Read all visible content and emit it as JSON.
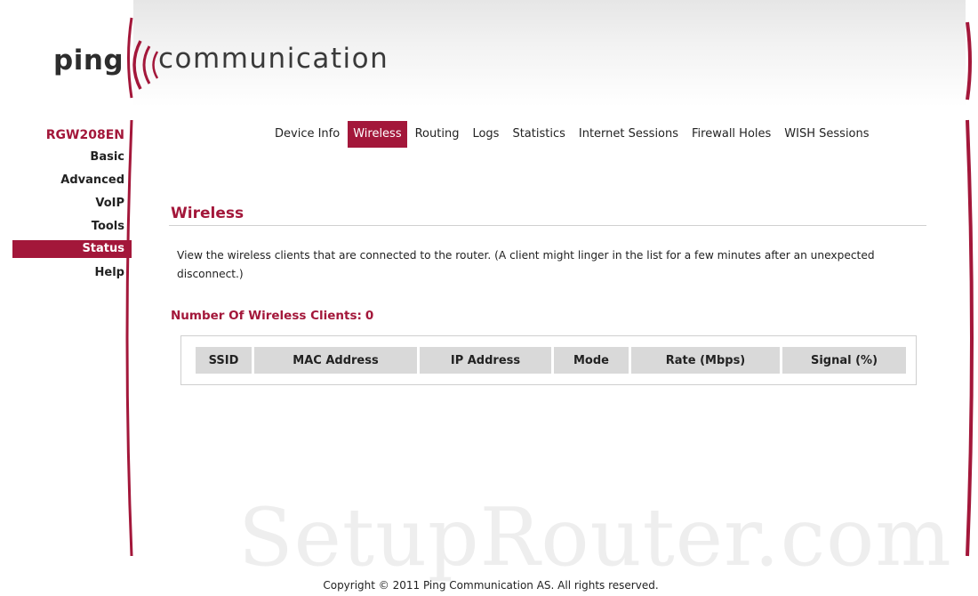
{
  "brand": {
    "logo_part1": "ping",
    "logo_part2": "communication",
    "accent_color": "#a3173a"
  },
  "sidebar": {
    "device_name": "RGW208EN",
    "items": [
      {
        "label": "Basic",
        "active": false
      },
      {
        "label": "Advanced",
        "active": false
      },
      {
        "label": "VoIP",
        "active": false
      },
      {
        "label": "Tools",
        "active": false
      },
      {
        "label": "Status",
        "active": true
      },
      {
        "label": "Help",
        "active": false
      }
    ]
  },
  "topnav": {
    "tabs": [
      {
        "label": "Device Info",
        "active": false
      },
      {
        "label": "Wireless",
        "active": true
      },
      {
        "label": "Routing",
        "active": false
      },
      {
        "label": "Logs",
        "active": false
      },
      {
        "label": "Statistics",
        "active": false
      },
      {
        "label": "Internet Sessions",
        "active": false
      },
      {
        "label": "Firewall Holes",
        "active": false
      },
      {
        "label": "WISH Sessions",
        "active": false
      }
    ]
  },
  "main": {
    "title": "Wireless",
    "description": "View the wireless clients that are connected to the router. (A client might linger in the list for a few minutes after an unexpected disconnect.)",
    "clients_label": "Number Of Wireless Clients:",
    "clients_count": "0",
    "table": {
      "columns": [
        "SSID",
        "MAC Address",
        "IP Address",
        "Mode",
        "Rate (Mbps)",
        "Signal (%)"
      ],
      "rows": []
    }
  },
  "watermark": "SetupRouter.com",
  "footer": {
    "copyright": "Copyright © 2011 Ping Communication AS. All rights reserved."
  }
}
